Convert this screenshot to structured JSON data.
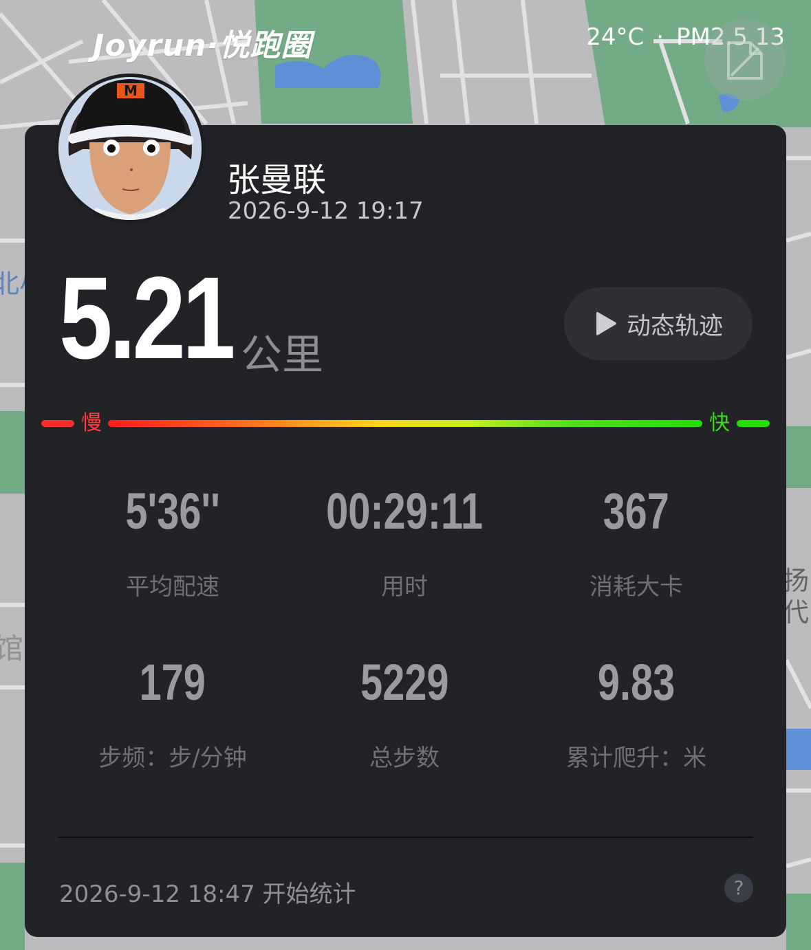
{
  "header": {
    "brand": "Joyrun·悦跑圈",
    "temperature": "24°C",
    "separator": "·",
    "air_quality": "PM2.5 13"
  },
  "map": {
    "label_left_top": "北小",
    "label_left_mid": "馆",
    "label_right_mid_1": "扬",
    "label_right_mid_2": "代"
  },
  "user": {
    "name": "张曼联",
    "run_datetime": "2026-9-12 19:17"
  },
  "distance": {
    "value": "5.21",
    "unit": "公里"
  },
  "track_button": {
    "label": "动态轨迹"
  },
  "speed_scale": {
    "slow_label": "慢",
    "fast_label": "快",
    "slow_color": "#ff2a2a",
    "fast_color": "#22e000"
  },
  "stats": [
    {
      "value": "5'36''",
      "label": "平均配速"
    },
    {
      "value": "00:29:11",
      "label": "用时"
    },
    {
      "value": "367",
      "label": "消耗大卡"
    },
    {
      "value": "179",
      "label": "步频：步/分钟"
    },
    {
      "value": "5229",
      "label": "总步数"
    },
    {
      "value": "9.83",
      "label": "累计爬升：米"
    }
  ],
  "footer": {
    "start_text": "2026-9-12 18:47 开始统计",
    "help_label": "?"
  },
  "colors": {
    "card_bg": "#222327",
    "map_green": "#72ab85",
    "map_water": "#5f8fd6"
  }
}
